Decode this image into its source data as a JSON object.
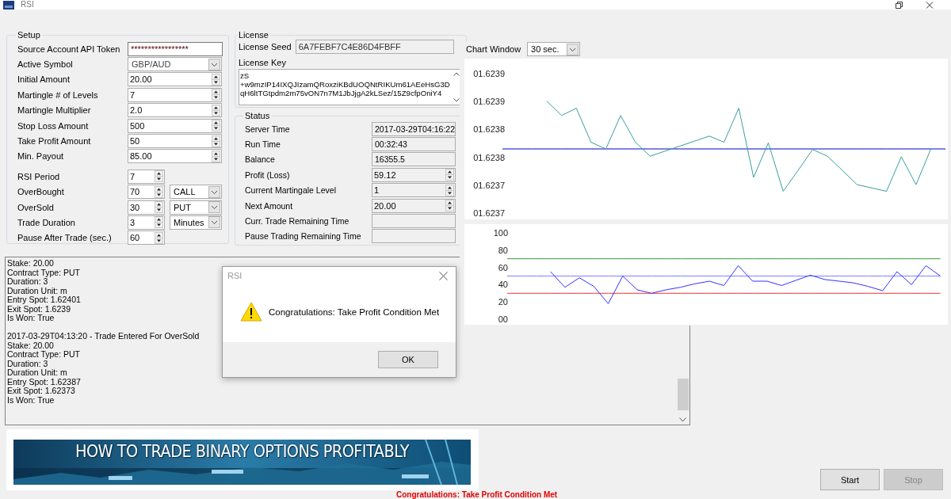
{
  "window": {
    "title": "RSI"
  },
  "setup": {
    "title": "Setup",
    "fields": [
      {
        "label": "Source Account API Token",
        "kind": "text",
        "value": "*****************"
      },
      {
        "label": "Active Symbol",
        "kind": "combo",
        "value": "GBP/AUD"
      },
      {
        "label": "Initial Amount",
        "kind": "spin",
        "value": "20.00"
      },
      {
        "label": "Martingle # of Levels",
        "kind": "spin",
        "value": "7"
      },
      {
        "label": "Martingle Multiplier",
        "kind": "spin",
        "value": "2.0"
      },
      {
        "label": "Stop Loss Amount",
        "kind": "spin",
        "value": "500"
      },
      {
        "label": "Take Profit Amount",
        "kind": "spin",
        "value": "50"
      },
      {
        "label": "Min. Payout",
        "kind": "spin",
        "value": "85.00"
      },
      {
        "label": "RSI Period",
        "kind": "short_spin",
        "value": "7"
      },
      {
        "label": "OverBought",
        "kind": "short_spin",
        "value": "70",
        "option": "CALL"
      },
      {
        "label": "OverSold",
        "kind": "short_spin",
        "value": "30",
        "option": "PUT"
      },
      {
        "label": "Trade Duration",
        "kind": "short_spin",
        "value": "3",
        "option": "Minutes"
      },
      {
        "label": "Pause After Trade (sec.)",
        "kind": "short_spin",
        "value": "60"
      }
    ]
  },
  "license": {
    "title": "License",
    "seed_label": "License Seed",
    "seed": "6A7FEBF7C4E86D4FBFF",
    "key_label": "License Key",
    "key_lines": [
      "zS",
      "+w9mzIP14IXQJIzamQRoxziKBdUOQNtRIKUm61AEeHsG3D",
      "qH6ltTGtpdm2m75vON7n7M1JbJjgA2kLSez/15Z9cfpOniY4"
    ]
  },
  "status": {
    "title": "Status",
    "fields": [
      {
        "label": "Server Time",
        "kind": "readonly",
        "value": "2017-03-29T04:16:22"
      },
      {
        "label": "Run Time",
        "kind": "readonly",
        "value": "00:32:43"
      },
      {
        "label": "Balance",
        "kind": "readonly",
        "value": "16355.5"
      },
      {
        "label": "Profit (Loss)",
        "kind": "spin",
        "value": "59.12"
      },
      {
        "label": "Current Martingale Level",
        "kind": "spin",
        "value": "1"
      },
      {
        "label": "Next Amount",
        "kind": "spin",
        "value": "20.00"
      },
      {
        "label": "Curr. Trade Remaining Time",
        "kind": "readonly"
      },
      {
        "label": "Pause Trading Remaining Time",
        "kind": "readonly"
      }
    ]
  },
  "chart_window": {
    "label": "Chart Window",
    "value": "30 sec."
  },
  "price_chart": {
    "chart_data": {
      "type": "line",
      "categories": [
        null,
        null,
        null,
        null,
        null,
        null,
        null,
        null,
        null,
        null,
        null,
        null,
        null,
        null,
        null,
        null,
        null,
        null,
        null,
        null,
        null,
        null,
        null,
        null,
        null,
        null,
        null,
        null,
        null,
        null,
        null
      ],
      "series": [
        {
          "color": "#3a9e9e",
          "values": [
            null,
            null,
            null,
            1.623851,
            1.623825,
            1.623838,
            1.623777,
            1.623765,
            1.623825,
            1.623777,
            1.623752,
            1.623761,
            1.62377,
            1.623779,
            1.623788,
            1.623777,
            1.623838,
            1.623714,
            1.623776,
            1.623689,
            1.623726,
            1.623764,
            1.623752,
            1.623727,
            1.623701,
            1.623695,
            1.623689,
            1.623751,
            1.623701,
            1.623765,
            null
          ]
        },
        {
          "color": "#0000cc",
          "values": [
            1.623765,
            1.623765,
            1.623765,
            1.623765,
            1.623765,
            1.623765,
            1.623765,
            1.623765,
            1.623765,
            1.623765,
            1.623765,
            1.623765,
            1.623765,
            1.623765,
            1.623765,
            1.623765,
            1.623765,
            1.623765,
            1.623765,
            1.623765,
            1.623765,
            1.623765,
            1.623765,
            1.623765,
            1.623765,
            1.623765,
            1.623765,
            1.623765,
            1.623765,
            1.623765,
            1.623765
          ]
        }
      ],
      "ylim": [
        1.62365,
        1.6239
      ],
      "yticks": [
        {
          "value": 1.6239,
          "label": "01.6239"
        },
        {
          "value": 1.62385,
          "label": "01.6239"
        },
        {
          "value": 1.6238,
          "label": "01.6238"
        },
        {
          "value": 1.62375,
          "label": "01.6238"
        },
        {
          "value": 1.6237,
          "label": "01.6237"
        },
        {
          "value": 1.62365,
          "label": "01.6237"
        }
      ]
    }
  },
  "rsi_chart": {
    "chart_data": {
      "type": "line",
      "categories": [
        null,
        null,
        null,
        null,
        null,
        null,
        null,
        null,
        null,
        null,
        null,
        null,
        null,
        null,
        null,
        null,
        null,
        null,
        null,
        null,
        null,
        null,
        null,
        null,
        null,
        null,
        null,
        null,
        null,
        null,
        null
      ],
      "series": [
        {
          "color": "#3333ff",
          "values": [
            null,
            null,
            null,
            55,
            37,
            48,
            38,
            18,
            50,
            34,
            30,
            34,
            37,
            41,
            44,
            39,
            62,
            44,
            44,
            39,
            45,
            51,
            46,
            44,
            42,
            38,
            33,
            55,
            40,
            62,
            50
          ]
        },
        {
          "color": "#339933",
          "values": [
            70,
            70,
            70,
            70,
            70,
            70,
            70,
            70,
            70,
            70,
            70,
            70,
            70,
            70,
            70,
            70,
            70,
            70,
            70,
            70,
            70,
            70,
            70,
            70,
            70,
            70,
            70,
            70,
            70,
            70,
            70
          ]
        },
        {
          "color": "#8080ff",
          "values": [
            50,
            50,
            50,
            50,
            50,
            50,
            50,
            50,
            50,
            50,
            50,
            50,
            50,
            50,
            50,
            50,
            50,
            50,
            50,
            50,
            50,
            50,
            50,
            50,
            50,
            50,
            50,
            50,
            50,
            50,
            50
          ]
        },
        {
          "color": "#ff3333",
          "values": [
            30,
            30,
            30,
            30,
            30,
            30,
            30,
            30,
            30,
            30,
            30,
            30,
            30,
            30,
            30,
            30,
            30,
            30,
            30,
            30,
            30,
            30,
            30,
            30,
            30,
            30,
            30,
            30,
            30,
            30,
            30
          ]
        }
      ],
      "ylim": [
        0,
        100
      ],
      "yticks": [
        {
          "value": 0,
          "label": "00"
        },
        {
          "value": 20,
          "label": "20"
        },
        {
          "value": 40,
          "label": "40"
        },
        {
          "value": 60,
          "label": "60"
        },
        {
          "value": 80,
          "label": "80"
        },
        {
          "value": 100,
          "label": "100"
        }
      ]
    }
  },
  "log": {
    "entries": [
      {
        "lines": [
          "Stake: 20.00",
          "Contract Type: PUT",
          "Duration: 3",
          "Duration Unit: m",
          "Entry Spot: 1.62401",
          "Exit Spot: 1.6239",
          "Is Won: True"
        ]
      },
      {
        "lines": [
          "2017-03-29T04:13:20 - Trade Entered For OverSold",
          "Stake: 20.00",
          "Contract Type: PUT",
          "Duration: 3",
          "Duration Unit: m",
          "Entry Spot: 1.62387",
          "Exit Spot: 1.62373",
          "Is Won: True"
        ]
      }
    ]
  },
  "dialog": {
    "title": "RSI",
    "message": "Congratulations: Take Profit Condition Met",
    "button": "OK"
  },
  "banner": {
    "title": "HOW TO TRADE BINARY OPTIONS PROFITABLY",
    "kind": "picture"
  },
  "buttons": [
    {
      "label": "Start",
      "disabled": false
    },
    {
      "label": "Stop",
      "disabled": true
    }
  ],
  "status_message": "Congratulations: Take Profit Condition Met"
}
